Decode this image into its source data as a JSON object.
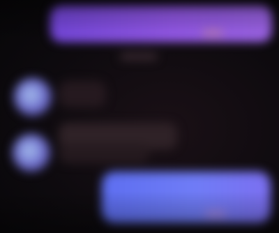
{
  "screen": {
    "type": "chat conversation (blurred, no legible text)",
    "colors": {
      "background": "#0c090f",
      "outgoing_bubble_top": "#8a52ec",
      "outgoing_bubble_bottom": "#6575f3",
      "incoming_bubble": "#2a1d23",
      "avatar": "#8aa3e6"
    }
  },
  "messages": [
    {
      "direction": "outgoing",
      "color": "#8a52ec",
      "icon": "message-bubble"
    },
    {
      "direction": "incoming",
      "color": "#2a1d23",
      "icon": "message-bubble"
    },
    {
      "direction": "incoming",
      "color": "#2a1d23",
      "icon": "message-bubble"
    },
    {
      "direction": "outgoing",
      "color": "#6575f3",
      "icon": "message-bubble"
    }
  ],
  "avatars": [
    "user-avatar",
    "user-avatar"
  ]
}
